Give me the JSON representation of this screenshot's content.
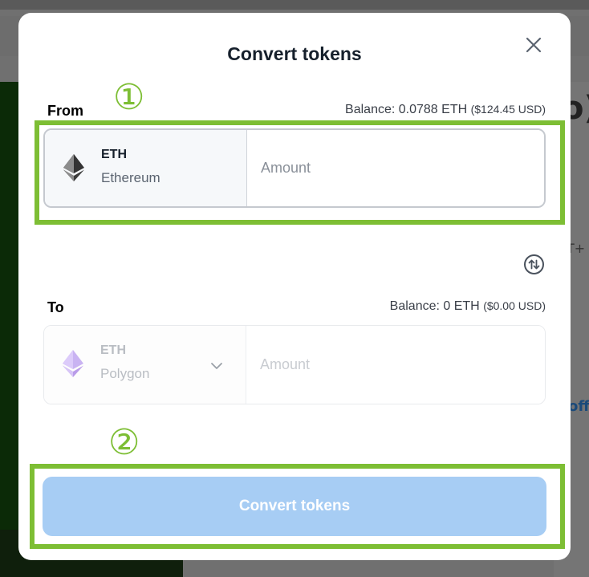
{
  "modal": {
    "title": "Convert tokens",
    "close_label": "close"
  },
  "from": {
    "label": "From",
    "balance_prefix": "Balance: ",
    "balance_amount": "0.0788 ETH",
    "balance_usd": "($124.45 USD)",
    "token_symbol": "ETH",
    "token_network": "Ethereum",
    "token_icon": "ethereum-icon",
    "amount_placeholder": "Amount"
  },
  "to": {
    "label": "To",
    "balance_prefix": "Balance: ",
    "balance_amount": "0 ETH",
    "balance_usd": "($0.00 USD)",
    "token_symbol": "ETH",
    "token_network": "Polygon",
    "token_icon": "ethereum-icon",
    "amount_placeholder": "Amount"
  },
  "swap": {
    "icon": "swap-arrows-icon"
  },
  "convert_button": {
    "label": "Convert tokens"
  },
  "annotations": {
    "step1": "①",
    "step2": "②",
    "color": "#7dbe34"
  },
  "background": {
    "right_glyph": "o)",
    "right_text": "T+",
    "right_link": "off"
  },
  "colors": {
    "button_disabled": "#a7cdf4",
    "title": "#16202c"
  }
}
